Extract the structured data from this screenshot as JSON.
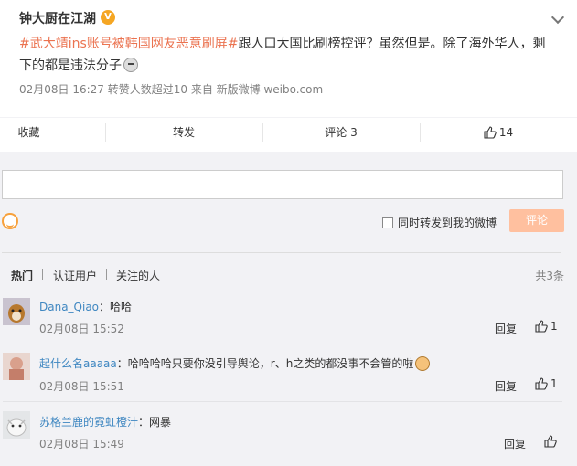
{
  "post": {
    "author": "钟大厨在江湖",
    "badge": "V",
    "hashtag": "#武大靖ins账号被韩国网友恶意刷屏#",
    "text": "跟人口大国比刷榜控评？虽然但是。除了海外华人，剩下的都是违法分子",
    "meta": "02月08日 16:27 转赞人数超过10  来自 新版微博 weibo.com"
  },
  "actions": {
    "favorite": "收藏",
    "repost": "转发",
    "comment": "评论 3",
    "like_count": "14"
  },
  "composer": {
    "placeholder": "",
    "repost_label": "同时转发到我的微博",
    "submit_label": "评论"
  },
  "filters": {
    "tabs": [
      "热门",
      "认证用户",
      "关注的人"
    ],
    "total": "共3条"
  },
  "comments": [
    {
      "name": "Dana_Qiao",
      "text": "：哈哈",
      "time": "02月08日 15:52",
      "reply": "回复",
      "likes": "1"
    },
    {
      "name": "起什么名aaaaa",
      "text": "：哈哈哈哈只要你没引导舆论，r、h之类的都没事不会管的啦",
      "time": "02月08日 15:51",
      "reply": "回复",
      "likes": "1"
    },
    {
      "name": "苏格兰鹿的霓虹橙汁",
      "text": "：网暴",
      "time": "02月08日 15:49",
      "reply": "回复",
      "likes": ""
    }
  ],
  "colors": {
    "link": "#3f87c1",
    "hashtag": "#eb7350",
    "submit_disabled": "#ffc09f",
    "badge": "#f5a623",
    "panel_bg": "#f2f2f5"
  }
}
